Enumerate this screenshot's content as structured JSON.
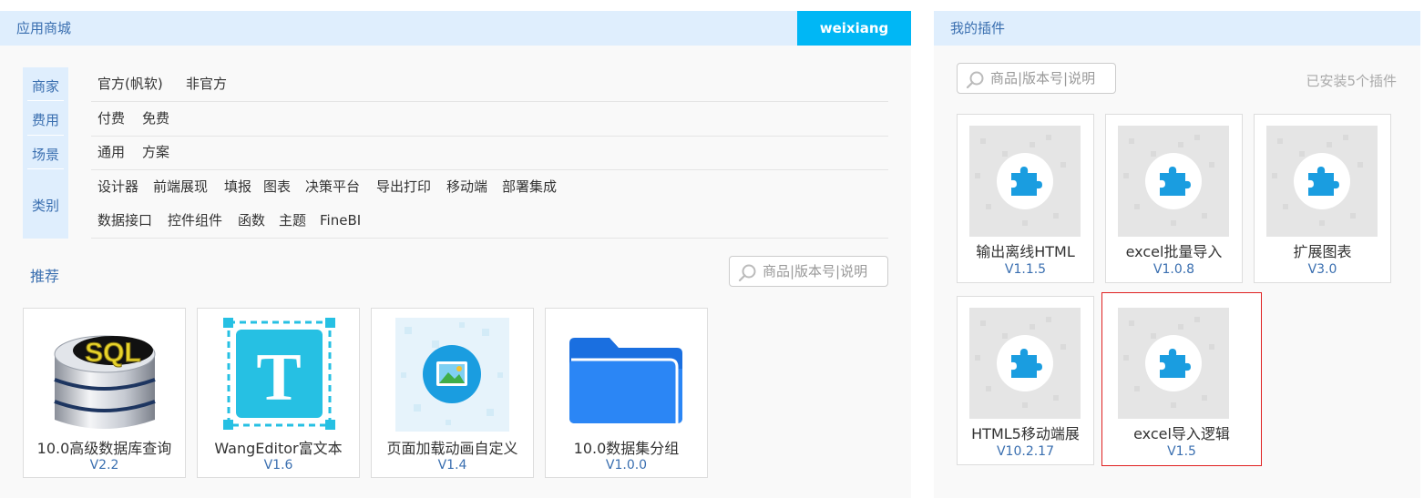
{
  "store": {
    "title": "应用商城",
    "user": "weixiang",
    "filter_labels": {
      "merchant": "商家",
      "fee": "费用",
      "scene": "场景",
      "category": "类别"
    },
    "merchant_options": [
      "官方(帆软)",
      "非官方"
    ],
    "fee_options": [
      "付费",
      "免费"
    ],
    "scene_options": [
      "通用",
      "方案"
    ],
    "category_options_row1": [
      "设计器",
      "前端展现",
      "填报",
      "图表",
      "决策平台",
      "导出打印",
      "移动端",
      "部署集成"
    ],
    "category_options_row2": [
      "数据接口",
      "控件组件",
      "函数",
      "主题",
      "FineBI"
    ],
    "recommend_label": "推荐",
    "search_placeholder": "商品|版本号|说明",
    "recommended": [
      {
        "name": "10.0高级数据库查询",
        "version": "V2.2",
        "icon": "sql-database-icon"
      },
      {
        "name": "WangEditor富文本",
        "version": "V1.6",
        "icon": "text-editor-icon"
      },
      {
        "name": "页面加载动画自定义",
        "version": "V1.4",
        "icon": "image-animation-icon"
      },
      {
        "name": "10.0数据集分组",
        "version": "V1.0.0",
        "icon": "folder-icon"
      }
    ]
  },
  "plugins": {
    "title": "我的插件",
    "search_placeholder": "商品|版本号|说明",
    "installed_text": "已安装5个插件",
    "items": [
      {
        "name": "输出离线HTML",
        "version": "V1.1.5",
        "icon": "puzzle-icon"
      },
      {
        "name": "excel批量导入",
        "version": "V1.0.8",
        "icon": "puzzle-icon"
      },
      {
        "name": "扩展图表",
        "version": "V3.0",
        "icon": "puzzle-icon"
      },
      {
        "name": "HTML5移动端展",
        "version": "V10.2.17",
        "icon": "puzzle-icon"
      },
      {
        "name": "excel导入逻辑",
        "version": "V1.5",
        "icon": "puzzle-icon",
        "selected": true
      }
    ]
  },
  "colors": {
    "accent": "#00b7f5",
    "header_bg": "#dfeefd",
    "link": "#3a6fb0",
    "selected_border": "#e02020",
    "puzzle": "#1a9de0"
  }
}
